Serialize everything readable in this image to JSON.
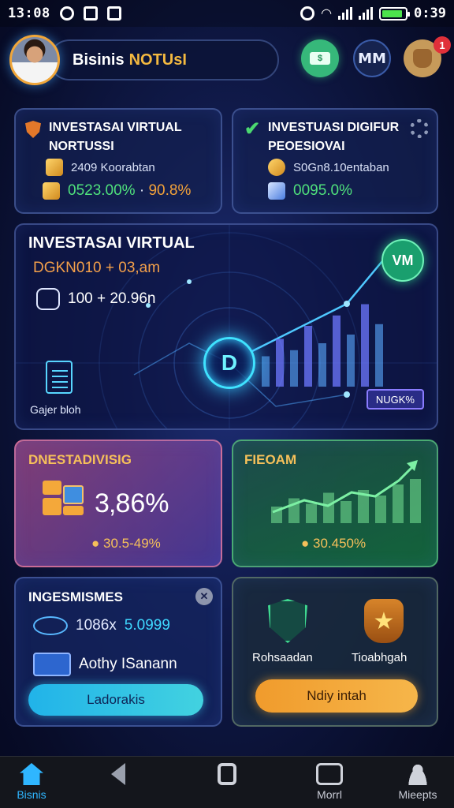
{
  "status": {
    "time": "13:08",
    "time_right": "0:39",
    "battery_level": 0.9
  },
  "header": {
    "name": "Bisinis",
    "name_accent": "NOTUsI",
    "mm_label": "MM",
    "notification_count": "1"
  },
  "cards": {
    "top_left": {
      "title_line1": "INVESTASAI VIRTUAL",
      "title_line2": "NORTUSSI",
      "row1": "2409 Koorabtan",
      "row2_green": "0523.00%",
      "row2_sep": " · ",
      "row2_orange": "90.8%"
    },
    "top_right": {
      "title_line1": "INVESTUASI DIGIFUR",
      "title_line2": "PEOESIOVAI",
      "row1": "S0Gn8.10entaban",
      "row2_green": "0095.0%"
    },
    "hero": {
      "title": "INVESTASAI VIRTUAL",
      "row1": "DGKN010 + 03,am",
      "row2": "100 + 20.96n",
      "badge": "VM",
      "core_glyph": "D",
      "footer": "Gajer bloh",
      "tag": "NUGK%",
      "chart_bars": [
        0.35,
        0.55,
        0.42,
        0.7,
        0.5,
        0.82,
        0.6,
        0.95,
        0.72
      ]
    },
    "mid_left": {
      "title": "DNESTADIVISIG",
      "value": "3‚86%",
      "sub": "30.5-49%"
    },
    "mid_right": {
      "title": "FIEOAM",
      "sub": "30.450%",
      "chart_bars": [
        0.3,
        0.45,
        0.35,
        0.55,
        0.4,
        0.6,
        0.5,
        0.7,
        0.8
      ]
    },
    "bottom_left": {
      "title": "INGESMISMES",
      "row1_a": "1086x",
      "row1_b": "5.0999",
      "row2": "Aothy ISanann",
      "cta": "Ladorakis"
    },
    "bottom_right": {
      "label_left": "Rohsaadan",
      "label_right": "Tioabhgah",
      "cta": "Ndiy intah"
    }
  },
  "nav": [
    {
      "label": "Bisnis",
      "active": true
    },
    {
      "label": "",
      "active": false
    },
    {
      "label": "",
      "active": false
    },
    {
      "label": "Morrl",
      "active": false
    },
    {
      "label": "Mieepts",
      "active": false
    }
  ],
  "colors": {
    "accent": "#2fb6ff",
    "green": "#4fe07c",
    "orange": "#f3a23a",
    "gold": "#f6c05a"
  }
}
